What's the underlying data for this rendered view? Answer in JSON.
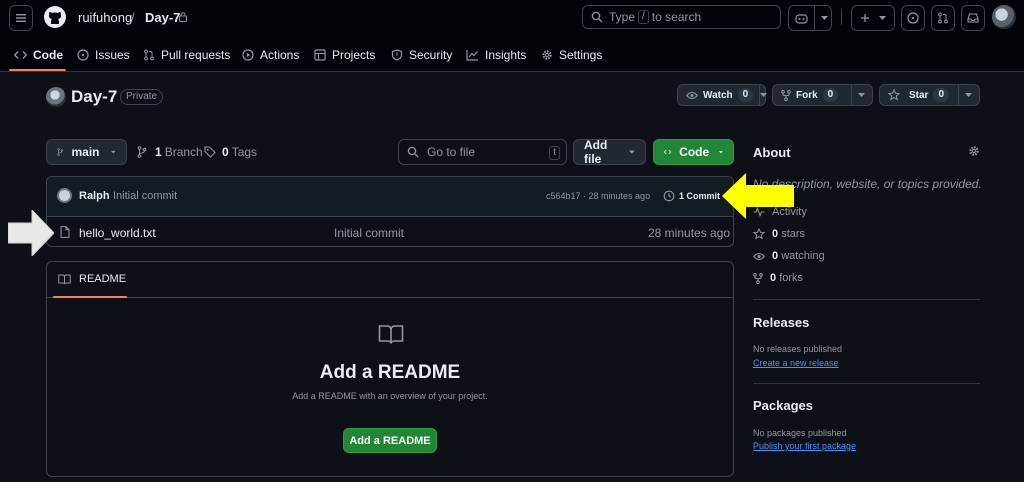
{
  "header": {
    "owner": "ruifuhong",
    "repo": "Day-7",
    "search_placeholder_pre": "Type",
    "search_key": "/",
    "search_placeholder_post": "to search"
  },
  "tabs": [
    {
      "label": "Code",
      "icon": "code-icon"
    },
    {
      "label": "Issues",
      "icon": "issue-icon"
    },
    {
      "label": "Pull requests",
      "icon": "pull-request-icon"
    },
    {
      "label": "Actions",
      "icon": "play-icon"
    },
    {
      "label": "Projects",
      "icon": "table-icon"
    },
    {
      "label": "Security",
      "icon": "shield-icon"
    },
    {
      "label": "Insights",
      "icon": "graph-icon"
    },
    {
      "label": "Settings",
      "icon": "gear-icon"
    }
  ],
  "repo": {
    "name": "Day-7",
    "visibility": "Private",
    "watch_label": "Watch",
    "watch_count": "0",
    "fork_label": "Fork",
    "fork_count": "0",
    "star_label": "Star",
    "star_count": "0"
  },
  "file_nav": {
    "branch": "main",
    "branches_count": "1",
    "branches_label": "Branch",
    "tags_count": "0",
    "tags_label": "Tags",
    "goto_placeholder": "Go to file",
    "goto_key": "t",
    "add_file_label": "Add file",
    "code_label": "Code"
  },
  "commit": {
    "author": "Ralph",
    "message": "Initial commit",
    "meta": "c564b17 · 28 minutes ago",
    "commits_label": "1 Commit"
  },
  "files": [
    {
      "name": "hello_world.txt",
      "message": "Initial commit",
      "age": "28 minutes ago"
    }
  ],
  "readme": {
    "tab_label": "README",
    "heading": "Add a README",
    "description": "Add a README with an overview of your project.",
    "button_label": "Add a README"
  },
  "about": {
    "title": "About",
    "description": "No description, website, or topics provided.",
    "activity_label": "Activity",
    "stars_count": "0",
    "stars_label": "stars",
    "watching_count": "0",
    "watching_label": "watching",
    "forks_count": "0",
    "forks_label": "forks"
  },
  "releases": {
    "title": "Releases",
    "empty_text": "No releases published",
    "create_link": "Create a new release"
  },
  "packages": {
    "title": "Packages",
    "empty_text": "No packages published",
    "publish_link": "Publish your first package"
  },
  "colors": {
    "accent_underline": "#f78166",
    "green_button": "#238636",
    "link_blue": "#4493f8",
    "annotation_arrow_yellow": "#ffff00",
    "annotation_arrow_white": "#e8e8e8"
  }
}
